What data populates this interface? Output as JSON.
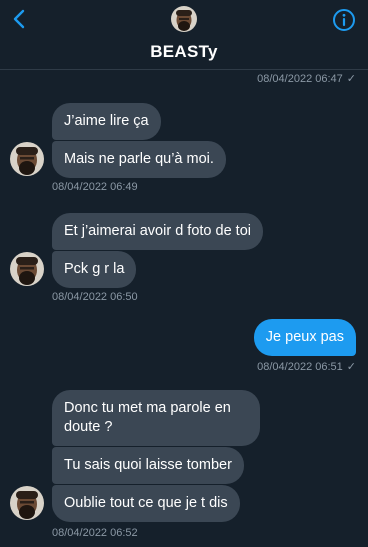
{
  "header": {
    "title": "BEASTy",
    "colors": {
      "background": "#15202b",
      "accent": "#1d9bf0",
      "bubble_in": "#3b4754"
    }
  },
  "messages": [
    {
      "direction": "out_status",
      "timestamp": "08/04/2022 06:47"
    },
    {
      "direction": "in",
      "bubbles": [
        "J’aime lire ça",
        "Mais ne parle qu’à moi."
      ],
      "timestamp": "08/04/2022 06:49"
    },
    {
      "direction": "in",
      "bubbles": [
        "Et j’aimerai avoir d foto de toi",
        "Pck g r la"
      ],
      "timestamp": "08/04/2022 06:50"
    },
    {
      "direction": "out",
      "bubbles": [
        "Je peux pas"
      ],
      "timestamp": "08/04/2022 06:51"
    },
    {
      "direction": "in",
      "bubbles": [
        "Donc tu met ma parole en doute ?",
        "Tu sais quoi laisse tomber",
        "Oublie tout ce que je t dis"
      ],
      "timestamp": "08/04/2022 06:52"
    }
  ],
  "read_check": "✓"
}
